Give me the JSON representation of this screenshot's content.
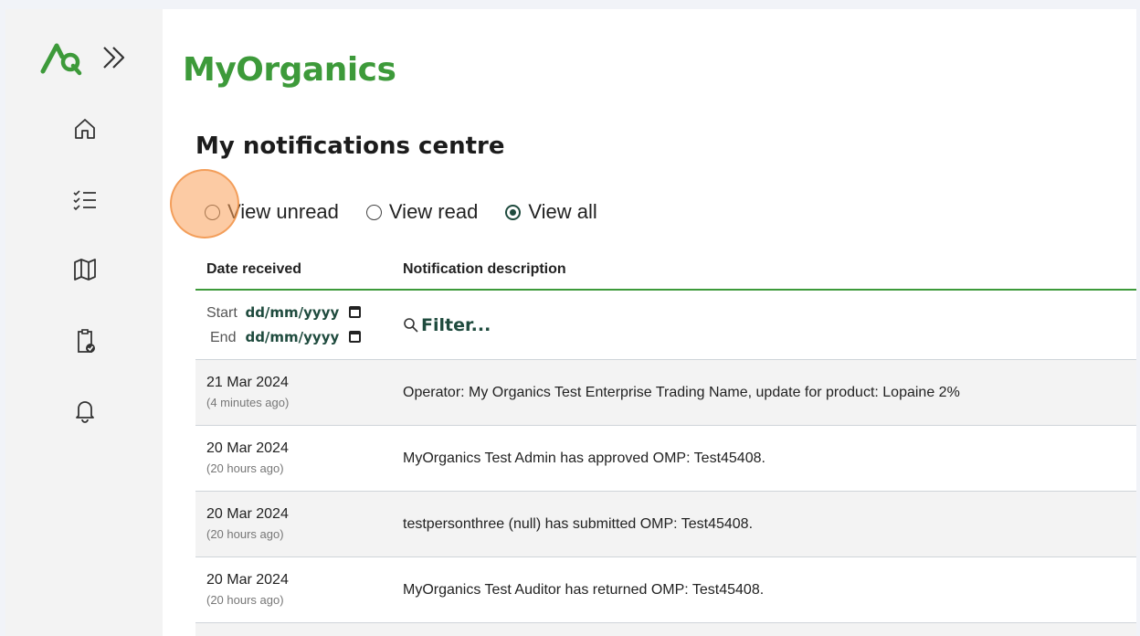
{
  "brand": {
    "title": "MyOrganics"
  },
  "sidebar": {
    "icons": [
      "logo-icon",
      "double-chevron-right-icon",
      "home-icon",
      "checklist-icon",
      "map-icon",
      "clipboard-check-icon",
      "bell-icon"
    ]
  },
  "page": {
    "title": "My notifications centre"
  },
  "view_filter": {
    "options": [
      {
        "label": "View unread",
        "selected": false
      },
      {
        "label": "View read",
        "selected": false
      },
      {
        "label": "View all",
        "selected": true
      }
    ]
  },
  "table": {
    "headers": {
      "date": "Date received",
      "description": "Notification description"
    },
    "filters": {
      "start_label": "Start",
      "end_label": "End",
      "start_value": "dd/mm/yyyy",
      "end_value": "dd/mm/yyyy",
      "search_placeholder": "Filter..."
    },
    "rows": [
      {
        "date": "21 Mar 2024",
        "ago": "(4 minutes ago)",
        "description": "Operator: My Organics Test Enterprise Trading Name, update for product: Lopaine 2%"
      },
      {
        "date": "20 Mar 2024",
        "ago": "(20 hours ago)",
        "description": "MyOrganics Test Admin has approved OMP: Test45408."
      },
      {
        "date": "20 Mar 2024",
        "ago": "(20 hours ago)",
        "description": "testpersonthree (null) has submitted OMP: Test45408."
      },
      {
        "date": "20 Mar 2024",
        "ago": "(20 hours ago)",
        "description": "MyOrganics Test Auditor has returned OMP: Test45408."
      }
    ]
  },
  "colors": {
    "brand_green": "#3d9a3a",
    "dark_green": "#1f4b3e",
    "click_marker": "#faa05a"
  }
}
